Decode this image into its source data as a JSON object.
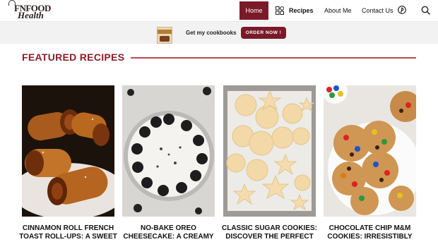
{
  "header": {
    "logo_line1": "FNFOOD",
    "logo_line2": "Health",
    "nav": {
      "home": "Home",
      "recipes": "Recipes",
      "about": "About Me",
      "contact": "Contact Us"
    },
    "icons": [
      "recipes-grid-icon",
      "pinterest-icon",
      "search-icon"
    ],
    "accent_color": "#7a1a28"
  },
  "cookbook_strip": {
    "text": "Get my cookbooks",
    "button": "ORDER NOW !"
  },
  "featured": {
    "title": "FEATURED RECIPES",
    "cards": [
      {
        "title": "CINNAMON ROLL FRENCH TOAST ROLL-UPS: A SWEET DELIGHT!"
      },
      {
        "title": "NO-BAKE OREO CHEESECAKE: A CREAMY DELIGHT AWAITS!"
      },
      {
        "title": "CLASSIC SUGAR COOKIES: DISCOVER THE PERFECT RECIPE!"
      },
      {
        "title": "CHOCOLATE CHIP M&M COOKIES: IRRESISTIBLY CHEWY RECIPE!"
      }
    ]
  }
}
